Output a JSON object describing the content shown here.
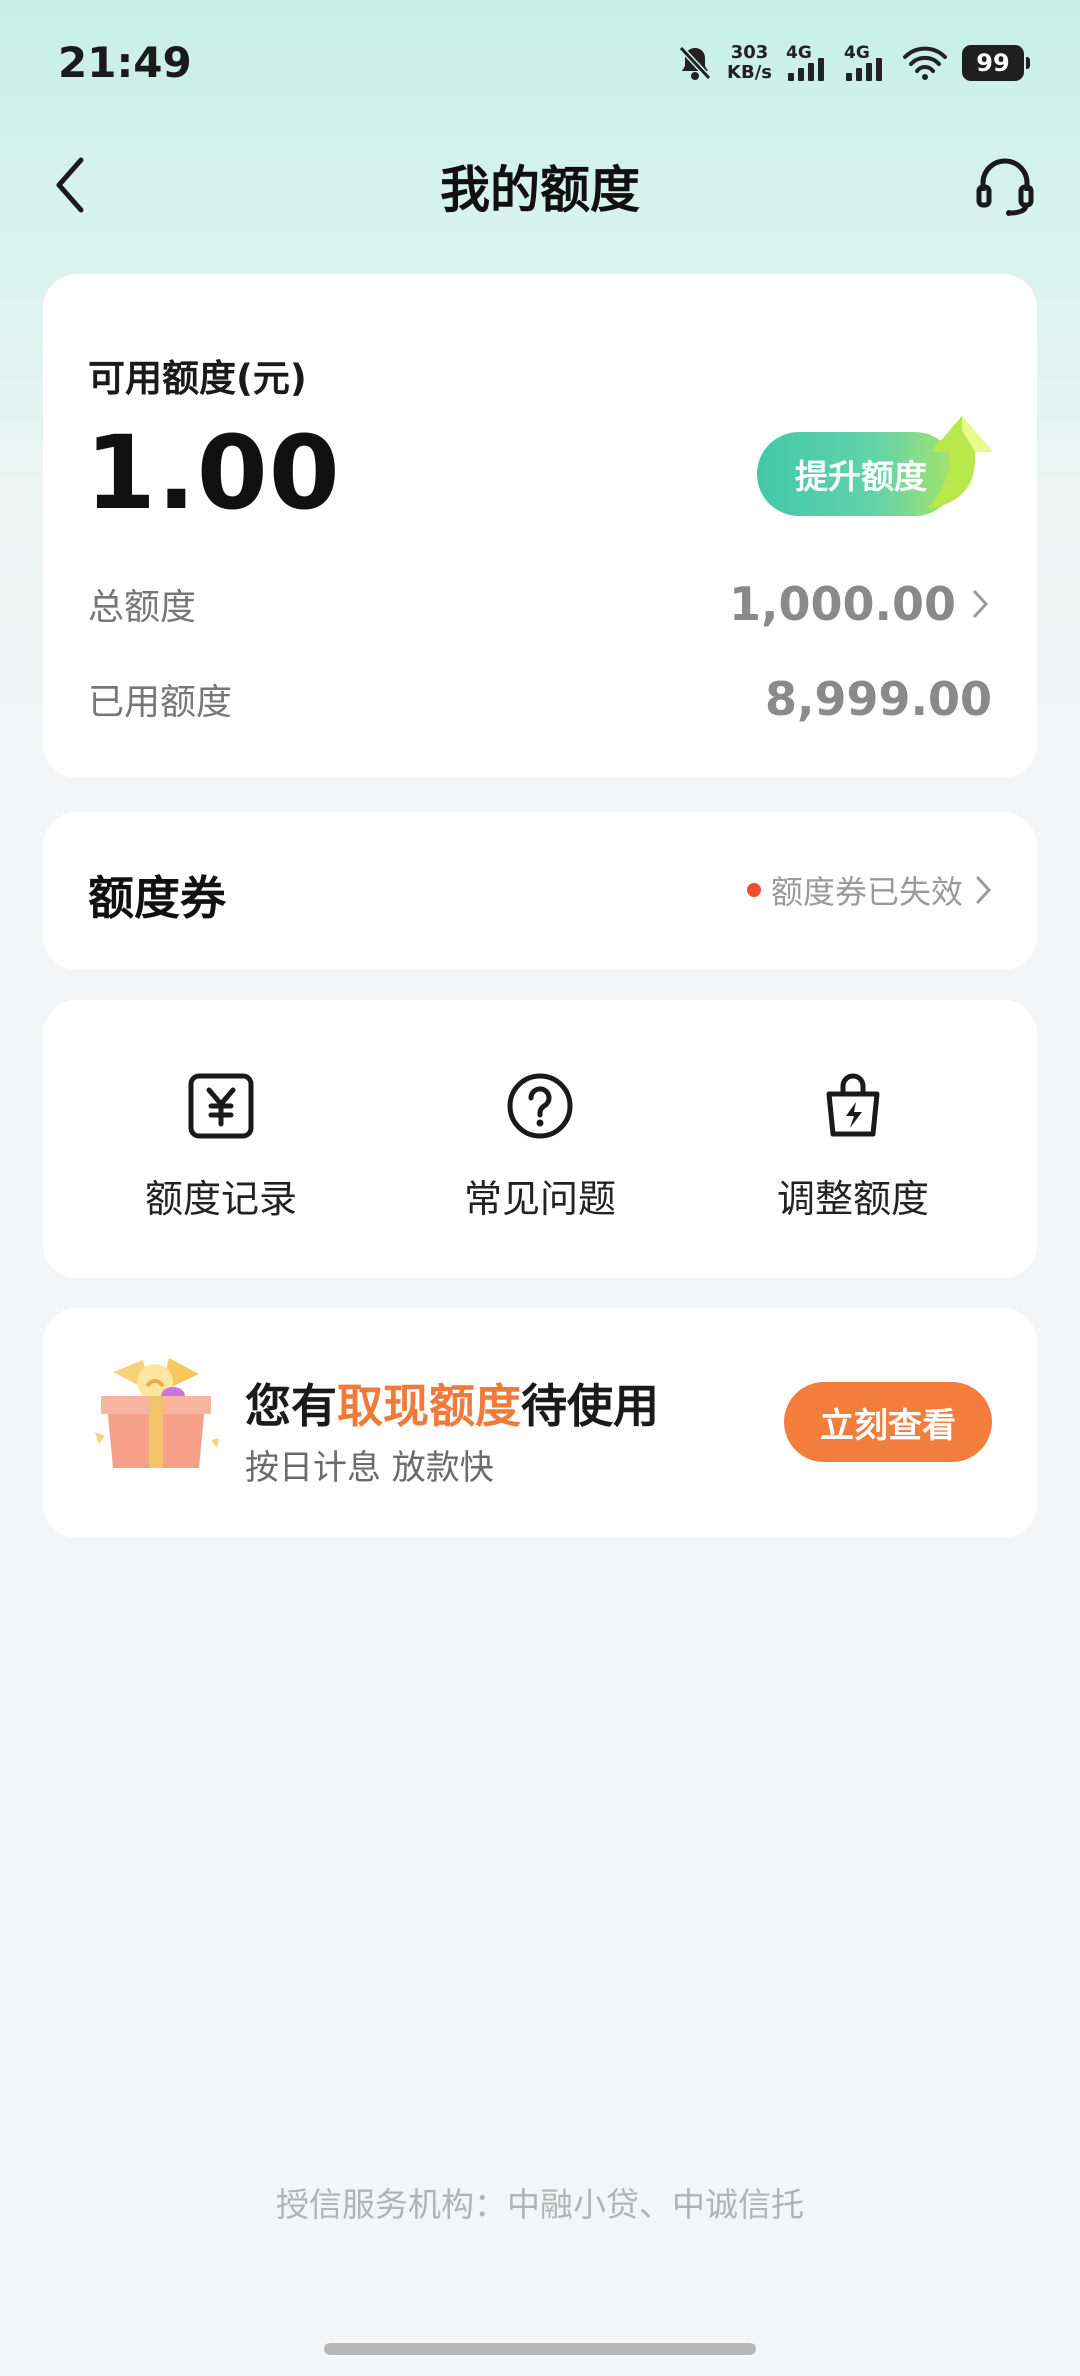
{
  "status_bar": {
    "time": "21:49",
    "net_speed_value": "303",
    "net_speed_unit": "KB/s",
    "sim1_label": "4G",
    "sim2_label": "4G",
    "battery": "99"
  },
  "header": {
    "title": "我的额度"
  },
  "quota": {
    "available_label": "可用额度(元)",
    "available_amount": "1.00",
    "raise_button": "提升额度",
    "total_label": "总额度",
    "total_value": "1,000.00",
    "used_label": "已用额度",
    "used_value": "8,999.00"
  },
  "coupon": {
    "title": "额度券",
    "status": "额度券已失效",
    "status_dot_color": "#ef4f2e"
  },
  "shortcuts": [
    {
      "label": "额度记录",
      "icon": "yuan-receipt-icon"
    },
    {
      "label": "常见问题",
      "icon": "question-circle-icon"
    },
    {
      "label": "调整额度",
      "icon": "lightning-bag-icon"
    }
  ],
  "promo": {
    "title_prefix": "您有",
    "title_highlight": "取现额度",
    "title_suffix": "待使用",
    "subtitle": "按日计息 放款快",
    "button": "立刻查看",
    "accent_color": "#f37d3d"
  },
  "footer": {
    "text": "授信服务机构：中融小贷、中诚信托"
  }
}
